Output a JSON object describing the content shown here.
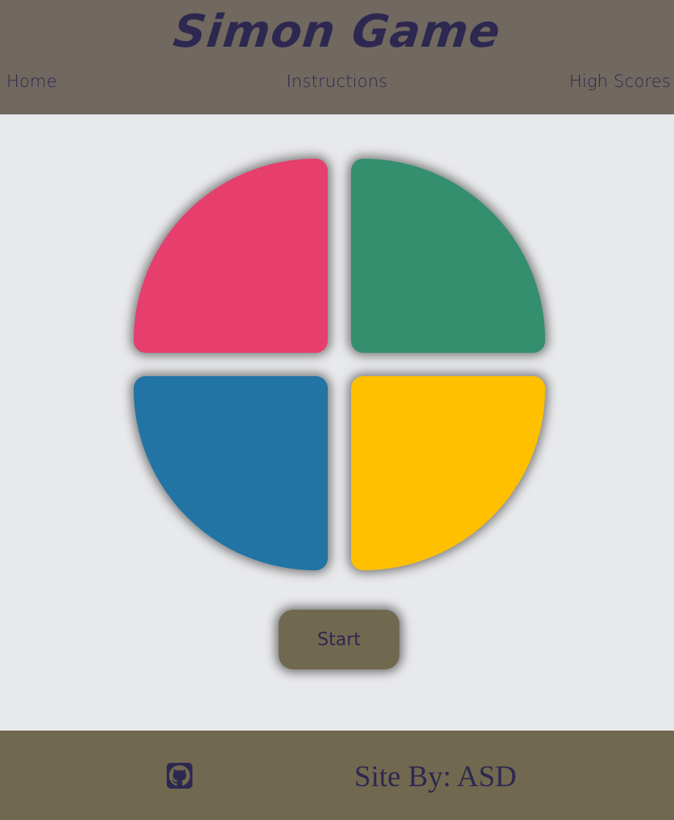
{
  "header": {
    "title": "Simon Game",
    "nav": {
      "home": "Home",
      "instructions": "Instructions",
      "high_scores": "High Scores"
    }
  },
  "board": {
    "pads": [
      {
        "color_name": "red",
        "color": "#e63e6d"
      },
      {
        "color_name": "green",
        "color": "#338f6d"
      },
      {
        "color_name": "blue",
        "color": "#2174a4"
      },
      {
        "color_name": "yellow",
        "color": "#ffc000"
      }
    ],
    "start_label": "Start"
  },
  "footer": {
    "icon": "github-icon",
    "credit": "Site By: ASD"
  },
  "colors": {
    "header_bg": "#716860",
    "footer_bg": "#716850",
    "text": "#2d2850",
    "main_bg": "#e8e9eb"
  }
}
